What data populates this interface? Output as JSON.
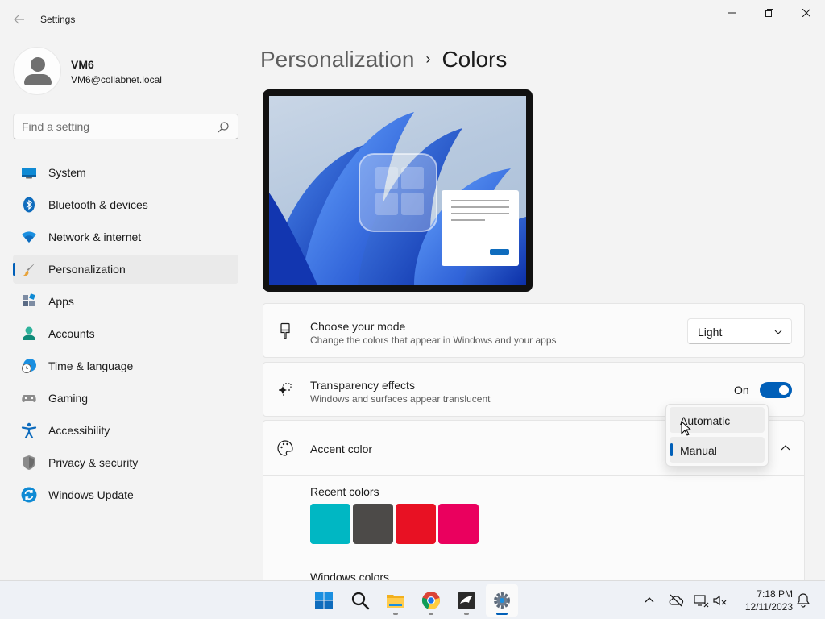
{
  "window": {
    "app_title": "Settings",
    "back_icon": "back-arrow-icon",
    "controls": [
      "minimize-icon",
      "maximize-icon",
      "close-icon"
    ]
  },
  "profile": {
    "name": "VM6",
    "email": "VM6@collabnet.local"
  },
  "search": {
    "placeholder": "Find a setting",
    "value": ""
  },
  "sidebar": {
    "items": [
      {
        "label": "System",
        "icon": "system-icon"
      },
      {
        "label": "Bluetooth & devices",
        "icon": "bluetooth-icon"
      },
      {
        "label": "Network & internet",
        "icon": "network-icon"
      },
      {
        "label": "Personalization",
        "icon": "personalization-icon",
        "active": true
      },
      {
        "label": "Apps",
        "icon": "apps-icon"
      },
      {
        "label": "Accounts",
        "icon": "accounts-icon"
      },
      {
        "label": "Time & language",
        "icon": "time-language-icon"
      },
      {
        "label": "Gaming",
        "icon": "gaming-icon"
      },
      {
        "label": "Accessibility",
        "icon": "accessibility-icon"
      },
      {
        "label": "Privacy & security",
        "icon": "privacy-shield-icon"
      },
      {
        "label": "Windows Update",
        "icon": "windows-update-icon"
      }
    ]
  },
  "breadcrumb": {
    "parent": "Personalization",
    "separator": "›",
    "current": "Colors"
  },
  "settings": {
    "mode": {
      "title": "Choose your mode",
      "subtitle": "Change the colors that appear in Windows and your apps",
      "value": "Light",
      "icon": "paintbrush-icon"
    },
    "transparency": {
      "title": "Transparency effects",
      "subtitle": "Windows and surfaces appear translucent",
      "state_label": "On",
      "enabled": true,
      "icon": "transparency-icon"
    },
    "accent": {
      "title": "Accent color",
      "icon": "palette-icon",
      "recent_label": "Recent colors",
      "recent_colors": [
        "#00b7c3",
        "#4c4a48",
        "#e81123",
        "#ea005e"
      ],
      "windows_label": "Windows colors"
    }
  },
  "accent_dropdown": {
    "options": [
      "Automatic",
      "Manual"
    ],
    "selected": "Manual",
    "hovered": "Automatic"
  },
  "taskbar": {
    "apps": [
      "start-icon",
      "search-icon",
      "file-explorer-icon",
      "chrome-icon",
      "app-icon",
      "settings-icon"
    ],
    "tray": [
      "chevron-up-icon",
      "onedrive-offline-icon",
      "network-icon",
      "volume-icon",
      "notification-bell-icon"
    ],
    "time": "7:18 PM",
    "date": "12/11/2023"
  },
  "colors": {
    "accent": "#005fb8",
    "background": "#f3f3f3",
    "card": "#fbfbfb"
  }
}
